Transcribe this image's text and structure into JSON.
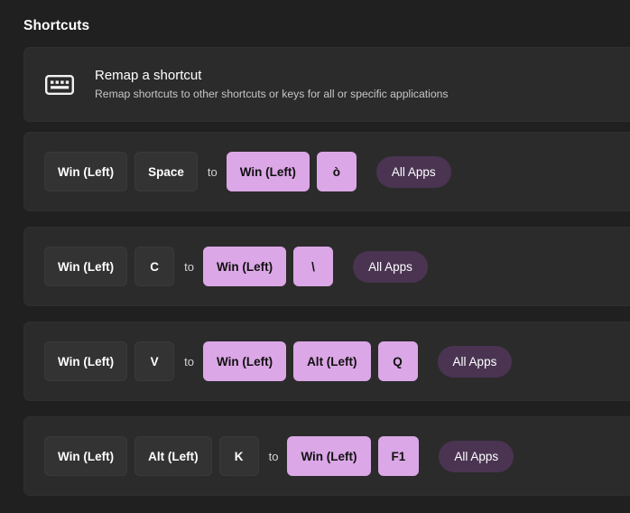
{
  "header": {
    "title": "Shortcuts"
  },
  "remap_card": {
    "icon": "keyboard-icon",
    "title": "Remap a shortcut",
    "subtitle": "Remap shortcuts to other shortcuts or keys for all or specific applications"
  },
  "labels": {
    "to": "to"
  },
  "colors": {
    "page_background": "#202020",
    "card_background": "#2b2b2b",
    "original_key": "#333333",
    "remapped_key": "#dba7e6",
    "apps_pill": "#4a3452",
    "text_primary": "#ffffff",
    "text_secondary": "#c6c6c6"
  },
  "shortcuts": [
    {
      "original": [
        "Win (Left)",
        "Space"
      ],
      "remapped": [
        "Win (Left)",
        "ò"
      ],
      "target_app": "All Apps"
    },
    {
      "original": [
        "Win (Left)",
        "C"
      ],
      "remapped": [
        "Win (Left)",
        "\\"
      ],
      "target_app": "All Apps"
    },
    {
      "original": [
        "Win (Left)",
        "V"
      ],
      "remapped": [
        "Win (Left)",
        "Alt (Left)",
        "Q"
      ],
      "target_app": "All Apps"
    },
    {
      "original": [
        "Win (Left)",
        "Alt (Left)",
        "K"
      ],
      "remapped": [
        "Win (Left)",
        "F1"
      ],
      "target_app": "All Apps"
    }
  ]
}
